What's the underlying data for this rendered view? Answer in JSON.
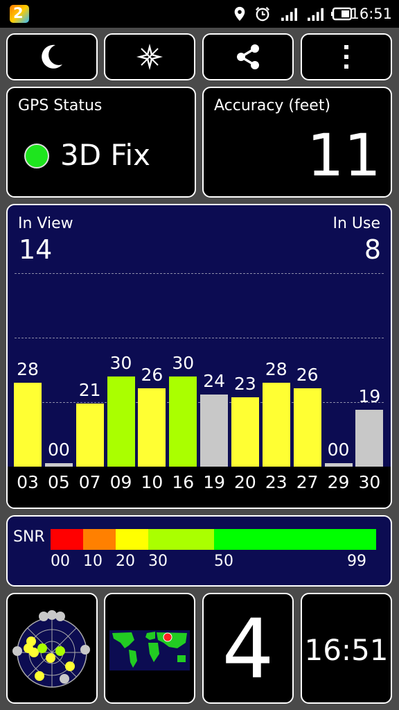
{
  "status_bar": {
    "app_badge": "2",
    "time": "16:51",
    "icons": [
      "app-badge-icon",
      "location-pin-icon",
      "alarm-clock-icon",
      "signal-1-icon",
      "signal-2-icon",
      "battery-icon"
    ]
  },
  "toolbar": {
    "buttons": [
      {
        "name": "night-mode-button",
        "icon": "moon-icon"
      },
      {
        "name": "compass-button",
        "icon": "compass-star-icon"
      },
      {
        "name": "share-button",
        "icon": "share-icon"
      },
      {
        "name": "menu-button",
        "icon": "more-vertical-icon"
      }
    ]
  },
  "gps_status": {
    "title": "GPS Status",
    "value": "3D Fix",
    "indicator_color": "#1ee51e"
  },
  "accuracy": {
    "title": "Accuracy (feet)",
    "value": "11"
  },
  "satellites": {
    "in_view_label": "In View",
    "in_view": "14",
    "in_use_label": "In Use",
    "in_use": "8"
  },
  "chart_data": {
    "type": "bar",
    "categories": [
      "03",
      "05",
      "07",
      "09",
      "10",
      "16",
      "19",
      "20",
      "23",
      "27",
      "29",
      "30"
    ],
    "values": [
      28,
      0,
      21,
      30,
      26,
      30,
      24,
      23,
      28,
      26,
      0,
      19
    ],
    "value_labels": [
      "28",
      "00",
      "21",
      "30",
      "26",
      "30",
      "24",
      "23",
      "28",
      "26",
      "00",
      "19"
    ],
    "bar_colors": [
      "#ffff33",
      "#cccccc",
      "#ffff33",
      "#aaff00",
      "#ffff33",
      "#aaff00",
      "#c8c8c8",
      "#ffff33",
      "#ffff33",
      "#ffff33",
      "#cccccc",
      "#c8c8c8"
    ],
    "ylim": [
      0,
      50
    ],
    "grid": true
  },
  "snr": {
    "label": "SNR",
    "ticks": [
      "00",
      "10",
      "20",
      "30",
      "50",
      "99"
    ],
    "segments": [
      {
        "from": 0,
        "to": 10,
        "color": "#ff0000"
      },
      {
        "from": 10,
        "to": 20,
        "color": "#ff8000"
      },
      {
        "from": 20,
        "to": 30,
        "color": "#ffff00"
      },
      {
        "from": 30,
        "to": 50,
        "color": "#aaff00"
      },
      {
        "from": 50,
        "to": 99,
        "color": "#00ff00"
      }
    ]
  },
  "bottom": {
    "count": "4",
    "clock": "16:51"
  }
}
